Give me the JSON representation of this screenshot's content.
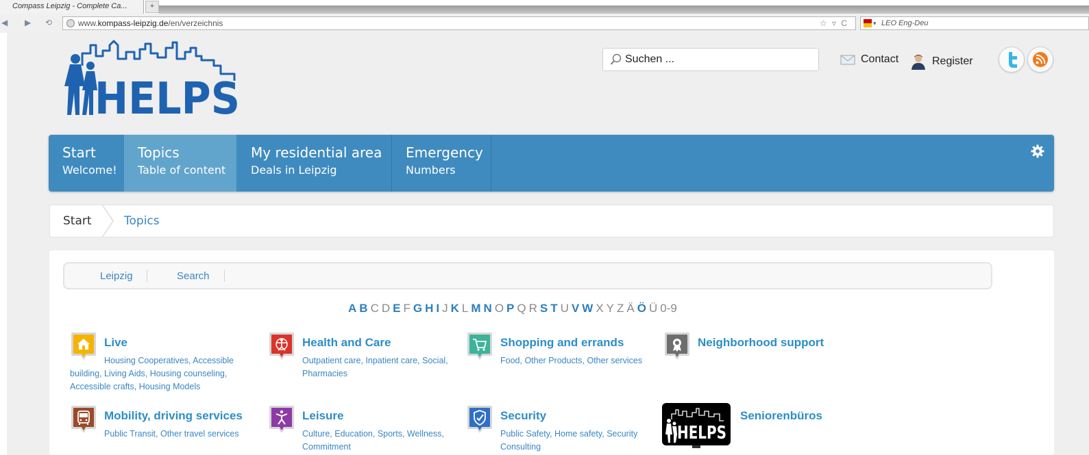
{
  "browser": {
    "tab_title": "Compass Leipzig - Complete Ca...",
    "new_tab": "+",
    "url_prefix": "www.",
    "url_domain": "kompass-leipzig.de",
    "url_path": "/en/verzeichnis",
    "url_tools": "☆ ▿ C",
    "search_engine": "LEO Eng-Deu"
  },
  "header": {
    "logo_text": "HELPS",
    "search_placeholder": "Suchen ...",
    "contact_label": "Contact",
    "register_label": "Register"
  },
  "nav": {
    "items": [
      {
        "title": "Start",
        "subtitle": "Welcome!"
      },
      {
        "title": "Topics",
        "subtitle": "Table of content"
      },
      {
        "title": "My residential area",
        "subtitle": "Deals in Leipzig"
      },
      {
        "title": "Emergency",
        "subtitle": "Numbers"
      }
    ]
  },
  "breadcrumb": {
    "items": [
      "Start",
      "Topics"
    ]
  },
  "filters": {
    "items": [
      "Leipzig",
      "Search"
    ]
  },
  "alphabet": [
    {
      "letter": "A",
      "active": true
    },
    {
      "letter": "B",
      "active": true
    },
    {
      "letter": "C",
      "active": false
    },
    {
      "letter": "D",
      "active": false
    },
    {
      "letter": "E",
      "active": true
    },
    {
      "letter": "F",
      "active": false
    },
    {
      "letter": "G",
      "active": true
    },
    {
      "letter": "H",
      "active": true
    },
    {
      "letter": "I",
      "active": true
    },
    {
      "letter": "J",
      "active": false
    },
    {
      "letter": "K",
      "active": true
    },
    {
      "letter": "L",
      "active": false
    },
    {
      "letter": "M",
      "active": true
    },
    {
      "letter": "N",
      "active": true
    },
    {
      "letter": "O",
      "active": false
    },
    {
      "letter": "P",
      "active": true
    },
    {
      "letter": "Q",
      "active": false
    },
    {
      "letter": "R",
      "active": false
    },
    {
      "letter": "S",
      "active": true
    },
    {
      "letter": "T",
      "active": true
    },
    {
      "letter": "U",
      "active": false
    },
    {
      "letter": "V",
      "active": true
    },
    {
      "letter": "W",
      "active": true
    },
    {
      "letter": "X",
      "active": false
    },
    {
      "letter": "Y",
      "active": false
    },
    {
      "letter": "Z",
      "active": false
    },
    {
      "letter": "Ä",
      "active": false
    },
    {
      "letter": "Ö",
      "active": true
    },
    {
      "letter": "Ü",
      "active": false
    },
    {
      "letter": "0-9",
      "active": false
    }
  ],
  "categories": [
    {
      "title": "Live",
      "icon": "home-icon",
      "color": "#f5b400",
      "links": [
        "Housing Cooperatives",
        "Accessible building",
        "Living Aids",
        "Housing counseling",
        "Accessible crafts",
        "Housing Models"
      ]
    },
    {
      "title": "Health and Care",
      "icon": "vitruvian-man-icon",
      "color": "#d9342b",
      "links": [
        "Outpatient care",
        "Inpatient care",
        "Social",
        "Pharmacies"
      ]
    },
    {
      "title": "Shopping and errands",
      "icon": "shopping-cart-icon",
      "color": "#3db39a",
      "links": [
        "Food",
        "Other Products",
        "Other services"
      ]
    },
    {
      "title": "Neighborhood support",
      "icon": "award-badge-icon",
      "color": "#6e6e6e",
      "links": []
    },
    {
      "title": "Mobility, driving services",
      "icon": "bus-icon",
      "color": "#9a4a2a",
      "links": [
        "Public Transit",
        "Other travel services"
      ]
    },
    {
      "title": "Leisure",
      "icon": "dancer-icon",
      "color": "#8e3aa6",
      "links": [
        "Culture",
        "Education",
        "Sports",
        "Wellness",
        "Commitment"
      ]
    },
    {
      "title": "Security",
      "icon": "shield-icon",
      "color": "#2f6fc6",
      "links": [
        "Public Safety",
        "Home safety",
        "Security Consulting"
      ]
    },
    {
      "title": "Seniorenbüros",
      "icon": "helps-logo-icon",
      "color": "#000000",
      "links": []
    }
  ]
}
